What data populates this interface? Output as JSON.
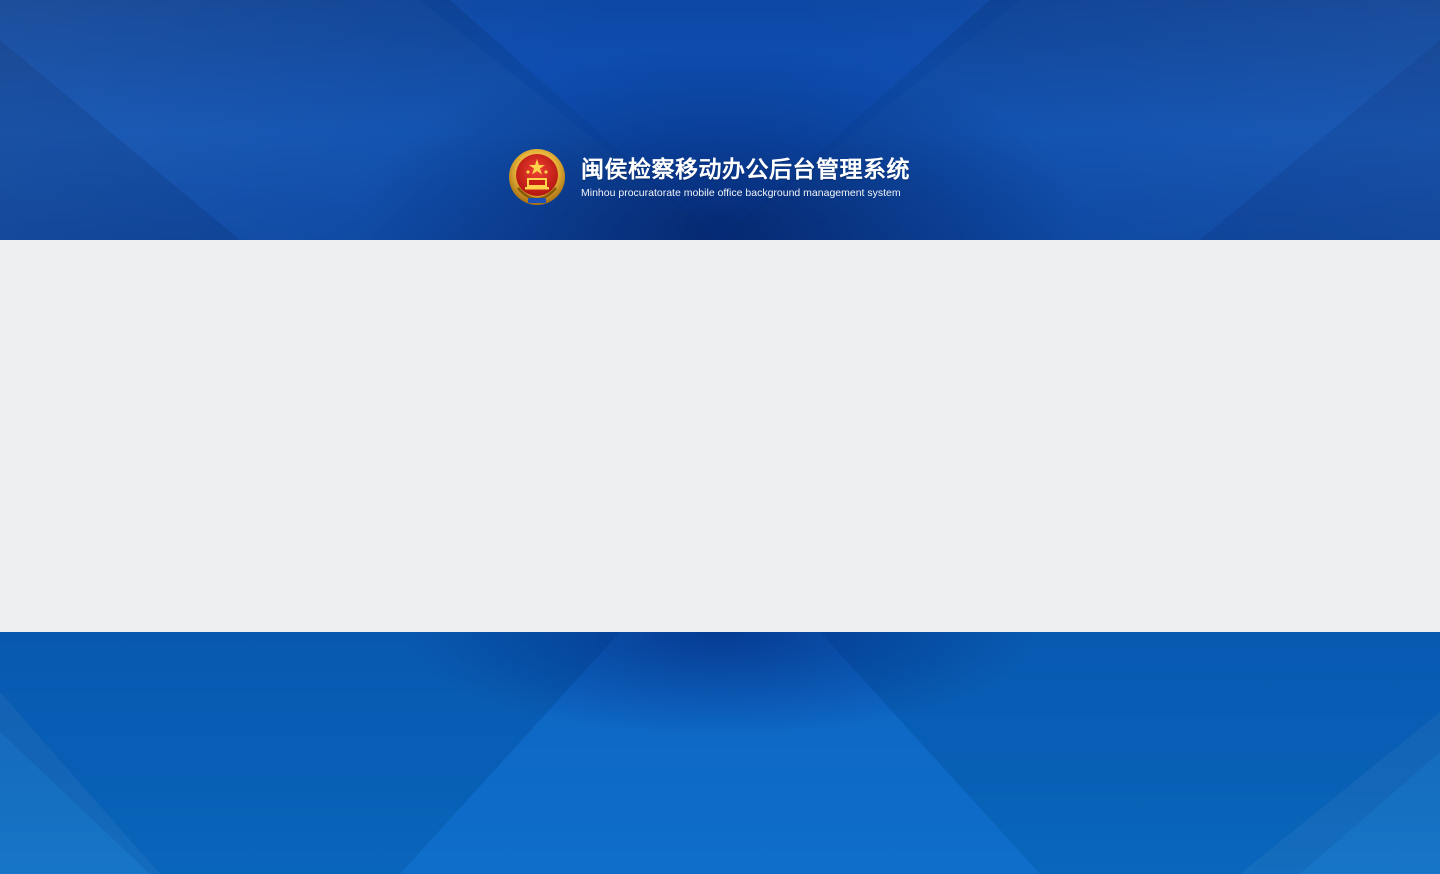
{
  "header": {
    "title_cn": "闽侯检察移动办公后台管理系统",
    "title_en": "Minhou procuratorate mobile office background management system",
    "logo_icon": "procuratorate-emblem-icon"
  },
  "colors": {
    "banner_top": "#0d4fb0",
    "banner_bottom": "#0a67bd",
    "content_bg": "#edeff1",
    "emblem_red": "#d7261e",
    "emblem_gold": "#e8b53a"
  }
}
